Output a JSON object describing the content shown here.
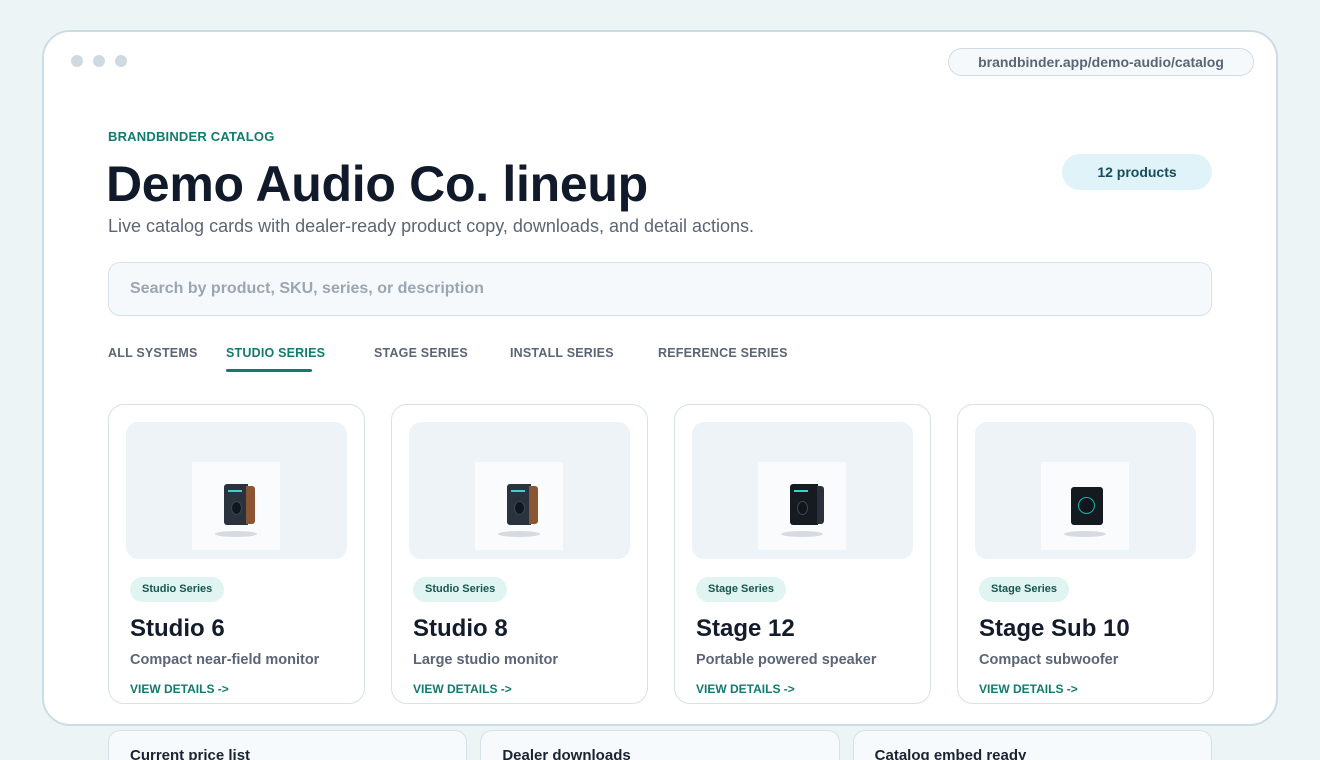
{
  "browser": {
    "url": "brandbinder.app/demo-audio/catalog"
  },
  "header": {
    "eyebrow": "BRANDBINDER CATALOG",
    "title": "Demo Audio Co. lineup",
    "subtitle": "Live catalog cards with dealer-ready product copy, downloads, and detail actions.",
    "count_badge": "12 products"
  },
  "search": {
    "placeholder": "Search by product, SKU, series, or description",
    "value": ""
  },
  "tabs": [
    {
      "label": "ALL SYSTEMS",
      "active": false
    },
    {
      "label": "STUDIO SERIES",
      "active": true
    },
    {
      "label": "STAGE SERIES",
      "active": false
    },
    {
      "label": "INSTALL SERIES",
      "active": false
    },
    {
      "label": "REFERENCE SERIES",
      "active": false
    }
  ],
  "products": [
    {
      "series": "Studio Series",
      "name": "Studio 6",
      "description": "Compact near-field monitor",
      "link": "VIEW DETAILS ->",
      "image_icon": "studio-monitor-icon"
    },
    {
      "series": "Studio Series",
      "name": "Studio 8",
      "description": "Large studio monitor",
      "link": "VIEW DETAILS ->",
      "image_icon": "studio-monitor-icon"
    },
    {
      "series": "Stage Series",
      "name": "Stage 12",
      "description": "Portable powered speaker",
      "link": "VIEW DETAILS ->",
      "image_icon": "powered-speaker-icon"
    },
    {
      "series": "Stage Series",
      "name": "Stage Sub 10",
      "description": "Compact subwoofer",
      "link": "VIEW DETAILS ->",
      "image_icon": "subwoofer-icon"
    }
  ],
  "info_cards": [
    {
      "title": "Current price list"
    },
    {
      "title": "Dealer downloads"
    },
    {
      "title": "Catalog embed ready"
    }
  ],
  "colors": {
    "accent": "#137a6e",
    "background": "#edf4f6",
    "title": "#111a2b",
    "badge_bg": "#dff3f8"
  }
}
